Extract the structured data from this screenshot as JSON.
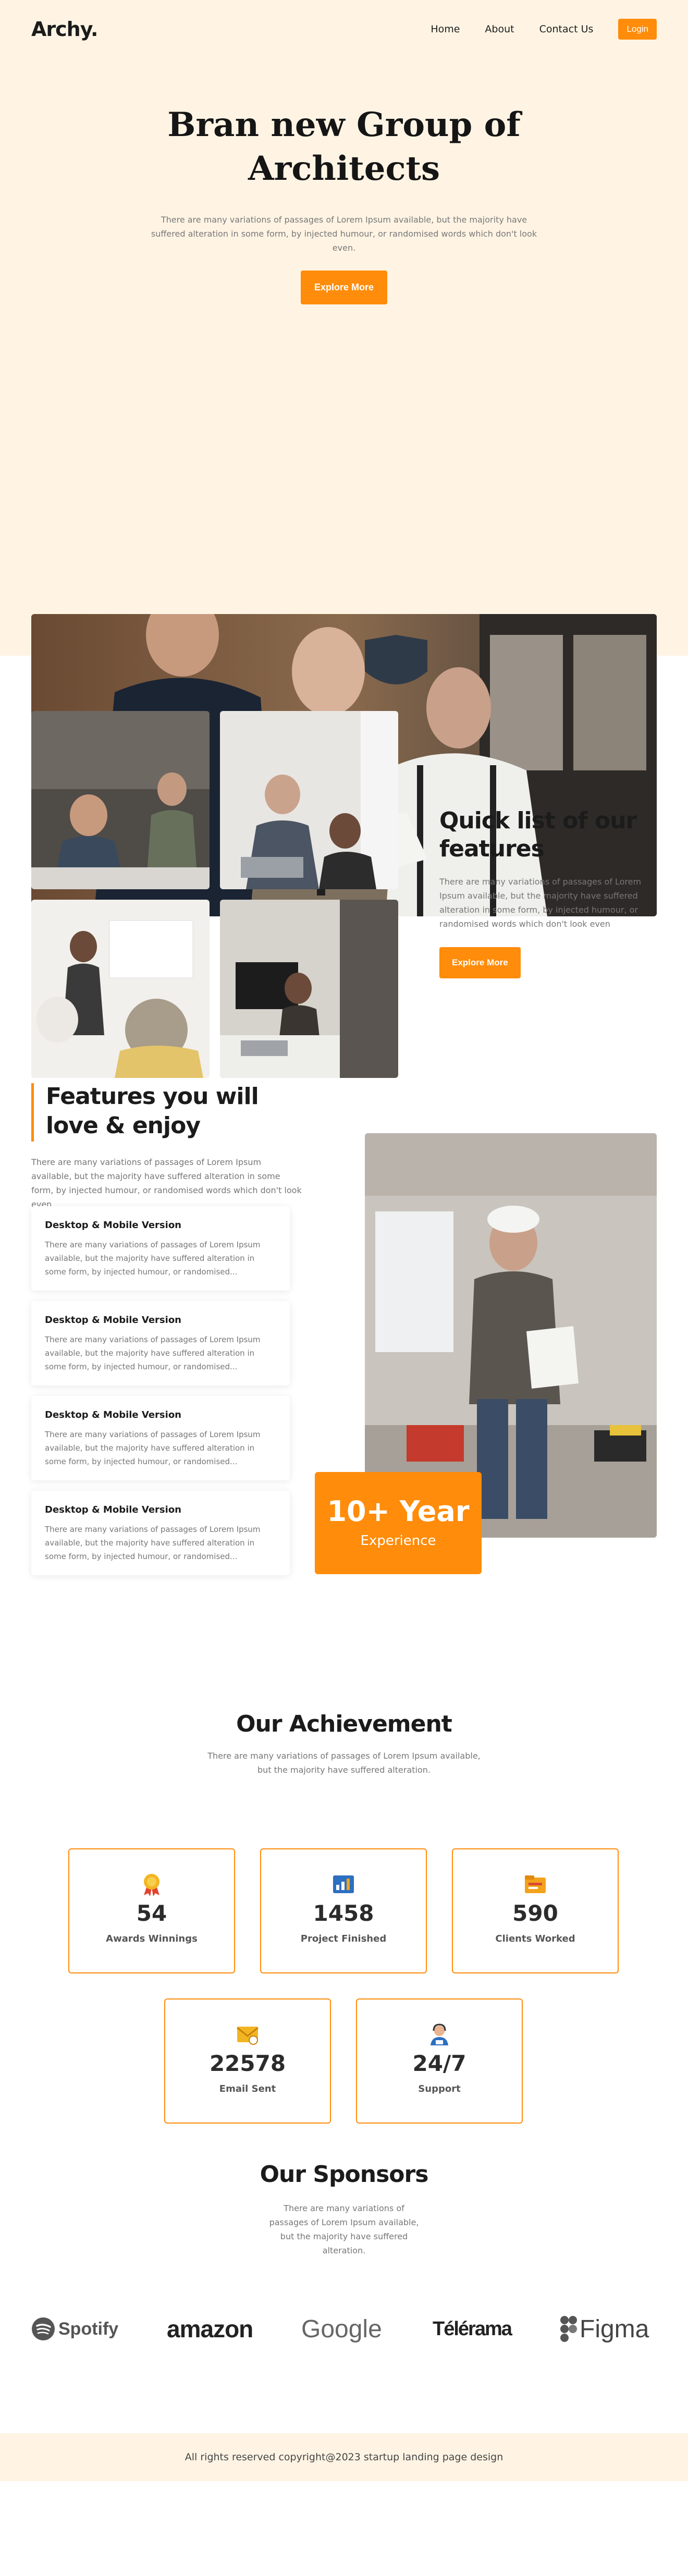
{
  "nav": {
    "logo": "Archy.",
    "links": [
      "Home",
      "About",
      "Contact Us"
    ],
    "login": "Login"
  },
  "hero": {
    "title_line1": "Bran new Group of",
    "title_line2": "Architects",
    "description": "There are many variations of passages of Lorem Ipsum available, but the majority have suffered alteration in some form, by injected humour, or randomised words which don't look even.",
    "cta": "Explore More"
  },
  "quick_list": {
    "title": "Quick list of our features",
    "description": "There are many variations of passages of Lorem Ipsum available, but the majority have suffered alteration in some form, by injected humour, or randomised words which don't look even",
    "cta": "Explore More"
  },
  "features": {
    "title": "Features you will love & enjoy",
    "description": "There are many variations of passages of Lorem Ipsum available, but the majority have suffered alteration in some form, by injected humour, or randomised words which don't look even",
    "cards": [
      {
        "title": "Desktop & Mobile Version",
        "text": "There are many variations of passages of Lorem Ipsum available, but the majority have suffered alteration in some form, by injected humour, or randomised..."
      },
      {
        "title": "Desktop & Mobile Version",
        "text": "There are many variations of passages of Lorem Ipsum available, but the majority have suffered alteration in some form, by injected humour, or randomised..."
      },
      {
        "title": "Desktop & Mobile Version",
        "text": "There are many variations of passages of Lorem Ipsum available, but the majority have suffered alteration in some form, by injected humour, or randomised..."
      },
      {
        "title": "Desktop & Mobile Version",
        "text": "There are many variations of passages of Lorem Ipsum available, but the majority have suffered alteration in some form, by injected humour, or randomised..."
      }
    ],
    "experience_number": "10+ Year",
    "experience_label": "Experience"
  },
  "achievement": {
    "title": "Our Achievement",
    "description": "There are many variations of passages of Lorem Ipsum available, but the majority have suffered alteration.",
    "items": [
      {
        "icon": "award-ribbon-icon",
        "number": "54",
        "label": "Awards Winnings"
      },
      {
        "icon": "project-chart-icon",
        "number": "1458",
        "label": "Project Finished"
      },
      {
        "icon": "clients-folder-icon",
        "number": "590",
        "label": "Clients Worked"
      },
      {
        "icon": "email-envelope-icon",
        "number": "22578",
        "label": "Email Sent"
      },
      {
        "icon": "support-agent-icon",
        "number": "24/7",
        "label": "Support"
      }
    ]
  },
  "sponsors": {
    "title": "Our Sponsors",
    "description": "There are many variations of passages of Lorem Ipsum available, but the majority have suffered alteration.",
    "logos": [
      "Spotify",
      "amazon",
      "Google",
      "Télérama",
      "Figma"
    ]
  },
  "footer": {
    "text": "All rights reserved copyright@2023 startup landing page design"
  },
  "colors": {
    "accent": "#ff8c0a",
    "hero_bg": "#fff4e4"
  }
}
